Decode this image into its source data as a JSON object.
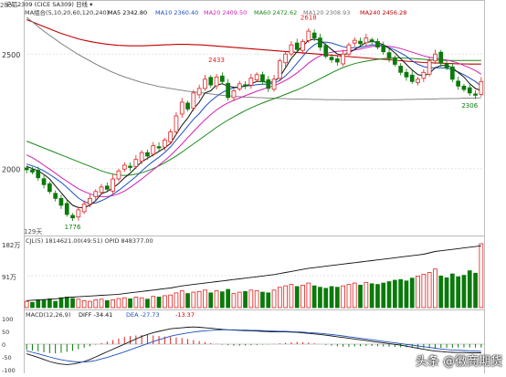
{
  "header": {
    "symbol_text": "沪铝2309 (CICE SA309) 日线 ▾",
    "ma_group_label": "MA组合(5,10,20,60,120,240)",
    "ma_values": [
      {
        "label": "MA5 2342.80",
        "color": "#111111"
      },
      {
        "label": "MA10 2360.40",
        "color": "#1e4fbf"
      },
      {
        "label": "MA20 2409.50",
        "color": "#d11fb5"
      },
      {
        "label": "MA60 2472.62",
        "color": "#1a8a1a"
      },
      {
        "label": "MA120 2308.93",
        "color": "#777777"
      },
      {
        "label": "MA240 2456.28",
        "color": "#c00000"
      }
    ]
  },
  "vol_header": {
    "main": "CJL(5) 1814621.00(49:51) OPID 848377.00",
    "cjl_color": "#1a8a1a"
  },
  "macd_header": {
    "main": "MACD(12,26,9)",
    "diff": "DIFF -34.41",
    "dea": "DEA -27.73",
    "macd": "-13.37",
    "diff_color": "#111111",
    "dea_color": "#1e4fbf",
    "macd_color": "#c00000"
  },
  "price_axis": [
    "2500",
    "2000"
  ],
  "price_left_notes": [
    "2ho",
    "129天"
  ],
  "vol_axis": [
    "182万",
    "91万"
  ],
  "macd_axis": [
    "100",
    "50",
    "0",
    "-50",
    "-100"
  ],
  "annotations": [
    "2433",
    "2618",
    "2306",
    "1776"
  ],
  "watermark": {
    "label": "头条 @徽商期货"
  },
  "colors": {
    "up": "#e02020",
    "down": "#0a7a0a",
    "bg": "#ffffff",
    "grid": "#e3e3e3"
  },
  "chart_data": [
    {
      "type": "candlestick",
      "ylim": [
        1740,
        2680
      ],
      "series_note": "daily candles, values estimated from axis",
      "close": [
        1995,
        1985,
        1960,
        1930,
        1900,
        1870,
        1840,
        1800,
        1785,
        1820,
        1845,
        1870,
        1900,
        1920,
        1910,
        1955,
        1990,
        2015,
        2005,
        2040,
        2070,
        2055,
        2100,
        2090,
        2125,
        2160,
        2230,
        2290,
        2260,
        2330,
        2350,
        2390,
        2365,
        2400,
        2380,
        2310,
        2340,
        2370,
        2360,
        2395,
        2410,
        2380,
        2350,
        2390,
        2470,
        2500,
        2540,
        2520,
        2555,
        2600,
        2570,
        2530,
        2490,
        2475,
        2465,
        2500,
        2540,
        2560,
        2545,
        2570,
        2555,
        2530,
        2510,
        2480,
        2455,
        2420,
        2400,
        2380,
        2390,
        2420,
        2470,
        2500,
        2460,
        2440,
        2390,
        2360,
        2345,
        2330,
        2320,
        2380
      ],
      "ma5": [
        2010,
        2000,
        1990,
        1975,
        1955,
        1925,
        1895,
        1865,
        1840,
        1830,
        1830,
        1840,
        1860,
        1890,
        1900,
        1915,
        1935,
        1960,
        1980,
        2005,
        2030,
        2045,
        2060,
        2075,
        2090,
        2110,
        2150,
        2190,
        2220,
        2260,
        2290,
        2330,
        2340,
        2365,
        2370,
        2360,
        2355,
        2355,
        2360,
        2370,
        2380,
        2380,
        2375,
        2380,
        2400,
        2440,
        2480,
        2510,
        2535,
        2560,
        2565,
        2560,
        2540,
        2520,
        2500,
        2495,
        2505,
        2520,
        2535,
        2550,
        2555,
        2550,
        2540,
        2525,
        2505,
        2480,
        2455,
        2430,
        2410,
        2405,
        2415,
        2440,
        2450,
        2450,
        2440,
        2420,
        2400,
        2370,
        2350,
        2340
      ],
      "ma10": [
        2020,
        2012,
        2002,
        1990,
        1975,
        1958,
        1940,
        1918,
        1895,
        1872,
        1856,
        1848,
        1850,
        1860,
        1872,
        1888,
        1905,
        1925,
        1945,
        1965,
        1990,
        2012,
        2032,
        2050,
        2070,
        2095,
        2125,
        2155,
        2185,
        2215,
        2240,
        2270,
        2295,
        2315,
        2332,
        2345,
        2352,
        2356,
        2360,
        2362,
        2366,
        2368,
        2368,
        2372,
        2385,
        2405,
        2430,
        2460,
        2490,
        2520,
        2540,
        2552,
        2552,
        2548,
        2540,
        2532,
        2528,
        2528,
        2530,
        2535,
        2540,
        2540,
        2535,
        2528,
        2518,
        2505,
        2490,
        2470,
        2455,
        2445,
        2440,
        2440,
        2440,
        2438,
        2432,
        2422,
        2410,
        2395,
        2380,
        2360
      ],
      "ma20": [
        2060,
        2048,
        2032,
        2015,
        1998,
        1980,
        1962,
        1945,
        1928,
        1912,
        1900,
        1890,
        1882,
        1878,
        1878,
        1882,
        1890,
        1902,
        1918,
        1936,
        1955,
        1975,
        1995,
        2015,
        2035,
        2058,
        2082,
        2108,
        2135,
        2162,
        2188,
        2213,
        2236,
        2256,
        2273,
        2287,
        2298,
        2308,
        2318,
        2328,
        2338,
        2346,
        2354,
        2362,
        2372,
        2385,
        2400,
        2418,
        2438,
        2460,
        2478,
        2492,
        2502,
        2508,
        2512,
        2514,
        2516,
        2518,
        2522,
        2528,
        2533,
        2536,
        2536,
        2534,
        2530,
        2524,
        2516,
        2508,
        2500,
        2492,
        2486,
        2482,
        2478,
        2474,
        2468,
        2460,
        2450,
        2440,
        2428,
        2412
      ],
      "ma60": [
        2120,
        2110,
        2100,
        2090,
        2080,
        2070,
        2060,
        2050,
        2040,
        2030,
        2020,
        2010,
        2000,
        1990,
        1982,
        1976,
        1972,
        1970,
        1972,
        1976,
        1982,
        1990,
        2000,
        2012,
        2025,
        2040,
        2055,
        2072,
        2090,
        2108,
        2126,
        2144,
        2162,
        2180,
        2196,
        2212,
        2226,
        2240,
        2253,
        2265,
        2276,
        2286,
        2296,
        2305,
        2314,
        2324,
        2334,
        2344,
        2355,
        2367,
        2379,
        2392,
        2405,
        2418,
        2430,
        2441,
        2450,
        2458,
        2464,
        2469,
        2473,
        2477,
        2480,
        2482,
        2483,
        2483,
        2482,
        2481,
        2479,
        2477,
        2475,
        2474,
        2473,
        2472,
        2472,
        2472,
        2472,
        2472,
        2472,
        2472
      ],
      "ma120": [
        2660,
        2640,
        2620,
        2600,
        2582,
        2564,
        2546,
        2530,
        2514,
        2498,
        2484,
        2470,
        2456,
        2444,
        2432,
        2420,
        2410,
        2400,
        2392,
        2384,
        2376,
        2370,
        2364,
        2358,
        2354,
        2350,
        2346,
        2342,
        2338,
        2335,
        2332,
        2329,
        2326,
        2323,
        2320,
        2318,
        2316,
        2314,
        2312,
        2311,
        2310,
        2309,
        2308,
        2307,
        2306,
        2305,
        2304,
        2304,
        2303,
        2303,
        2302,
        2302,
        2301,
        2301,
        2301,
        2300,
        2300,
        2300,
        2300,
        2300,
        2300,
        2300,
        2300,
        2300,
        2301,
        2301,
        2302,
        2302,
        2303,
        2303,
        2304,
        2304,
        2305,
        2305,
        2306,
        2306,
        2307,
        2307,
        2308,
        2309
      ],
      "ma240": [
        2650,
        2640,
        2630,
        2620,
        2610,
        2600,
        2590,
        2582,
        2574,
        2566,
        2560,
        2555,
        2550,
        2546,
        2543,
        2540,
        2538,
        2537,
        2536,
        2536,
        2536,
        2537,
        2538,
        2539,
        2540,
        2541,
        2542,
        2542,
        2542,
        2541,
        2540,
        2539,
        2537,
        2535,
        2533,
        2531,
        2529,
        2527,
        2525,
        2523,
        2521,
        2519,
        2517,
        2515,
        2513,
        2511,
        2509,
        2507,
        2505,
        2503,
        2501,
        2499,
        2497,
        2495,
        2493,
        2491,
        2489,
        2487,
        2485,
        2483,
        2481,
        2479,
        2477,
        2475,
        2473,
        2471,
        2469,
        2467,
        2465,
        2463,
        2462,
        2461,
        2460,
        2459,
        2458,
        2457,
        2457,
        2456,
        2456,
        2456
      ]
    },
    {
      "type": "bar",
      "series_note": "volume / open interest (万)",
      "ylim": [
        0,
        182
      ],
      "volume": [
        18,
        15,
        20,
        22,
        25,
        18,
        28,
        30,
        26,
        24,
        20,
        18,
        22,
        24,
        20,
        22,
        26,
        28,
        25,
        30,
        28,
        24,
        32,
        30,
        34,
        36,
        42,
        48,
        40,
        44,
        46,
        50,
        42,
        48,
        45,
        52,
        40,
        44,
        46,
        50,
        48,
        44,
        42,
        50,
        58,
        62,
        66,
        60,
        64,
        70,
        62,
        58,
        55,
        60,
        58,
        62,
        66,
        70,
        64,
        72,
        68,
        66,
        70,
        74,
        78,
        80,
        76,
        84,
        90,
        95,
        100,
        110,
        90,
        85,
        96,
        88,
        92,
        105,
        98,
        182
      ],
      "open_interest": [
        20,
        21,
        22,
        23,
        24,
        25,
        27,
        29,
        30,
        31,
        32,
        33,
        34,
        35,
        36,
        37,
        38,
        40,
        42,
        44,
        46,
        48,
        50,
        52,
        54,
        56,
        59,
        62,
        64,
        66,
        68,
        70,
        72,
        74,
        76,
        78,
        80,
        82,
        84,
        86,
        88,
        90,
        92,
        94,
        97,
        100,
        103,
        106,
        109,
        112,
        114,
        116,
        118,
        120,
        122,
        124,
        126,
        128,
        130,
        132,
        134,
        136,
        138,
        140,
        142,
        144,
        146,
        148,
        150,
        152,
        156,
        160,
        162,
        164,
        166,
        168,
        170,
        172,
        174,
        176
      ]
    },
    {
      "type": "bar",
      "series_note": "MACD histogram with DIFF and DEA",
      "ylim": [
        -100,
        100
      ],
      "macd_hist": [
        -22,
        -25,
        -28,
        -32,
        -35,
        -36,
        -34,
        -30,
        -26,
        -20,
        -14,
        -8,
        -2,
        4,
        10,
        16,
        22,
        28,
        32,
        34,
        36,
        36,
        34,
        32,
        30,
        28,
        26,
        24,
        20,
        16,
        12,
        8,
        4,
        1,
        -2,
        -4,
        -6,
        -6,
        -5,
        -4,
        -3,
        -2,
        -1,
        1,
        3,
        5,
        7,
        9,
        8,
        6,
        3,
        0,
        -3,
        -6,
        -8,
        -10,
        -10,
        -9,
        -8,
        -7,
        -7,
        -8,
        -9,
        -10,
        -11,
        -12,
        -12,
        -13,
        -14,
        -15,
        -16,
        -16,
        -15,
        -14,
        -14,
        -13,
        -13,
        -13,
        -13,
        -13
      ],
      "diff": [
        -38,
        -45,
        -52,
        -60,
        -68,
        -74,
        -78,
        -80,
        -78,
        -74,
        -68,
        -60,
        -50,
        -40,
        -30,
        -20,
        -10,
        0,
        10,
        20,
        30,
        38,
        45,
        50,
        55,
        60,
        62,
        64,
        66,
        67,
        66,
        64,
        62,
        60,
        58,
        56,
        55,
        54,
        53,
        52,
        51,
        50,
        49,
        48,
        48,
        48,
        47,
        46,
        44,
        42,
        40,
        38,
        35,
        32,
        29,
        26,
        23,
        20,
        17,
        14,
        11,
        8,
        5,
        2,
        -1,
        -4,
        -8,
        -12,
        -16,
        -20,
        -24,
        -27,
        -29,
        -31,
        -32,
        -33,
        -33,
        -34,
        -34,
        -34
      ],
      "dea": [
        -26,
        -32,
        -38,
        -44,
        -50,
        -56,
        -61,
        -65,
        -68,
        -70,
        -70,
        -68,
        -64,
        -58,
        -52,
        -45,
        -38,
        -30,
        -22,
        -14,
        -6,
        2,
        10,
        17,
        24,
        31,
        36,
        40,
        44,
        47,
        50,
        52,
        54,
        55,
        56,
        56,
        56,
        55,
        55,
        54,
        54,
        53,
        52,
        51,
        50,
        50,
        49,
        48,
        47,
        45,
        44,
        42,
        40,
        38,
        35,
        32,
        29,
        26,
        23,
        20,
        17,
        14,
        11,
        8,
        5,
        2,
        -1,
        -4,
        -7,
        -10,
        -13,
        -16,
        -19,
        -21,
        -23,
        -24,
        -25,
        -26,
        -27,
        -27.73
      ]
    }
  ]
}
